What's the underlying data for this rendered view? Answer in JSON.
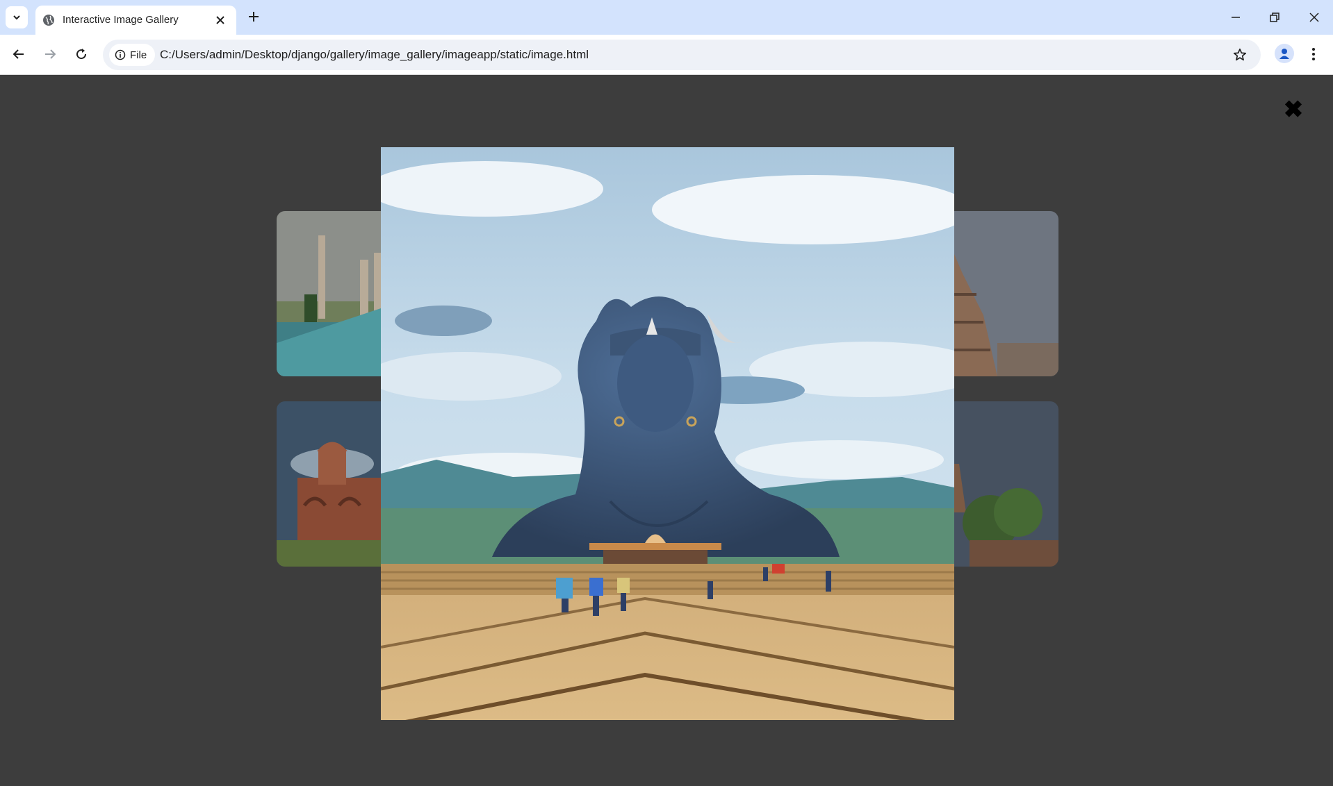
{
  "browser": {
    "tab": {
      "title": "Interactive Image Gallery",
      "favicon": "globe-icon",
      "close_icon": "close-icon"
    },
    "new_tab_icon": "plus-icon",
    "window_controls": [
      "minimize-icon",
      "restore-icon",
      "close-icon"
    ],
    "toolbar": {
      "back_icon": "back-arrow-icon",
      "forward_icon": "forward-arrow-icon",
      "reload_icon": "reload-icon",
      "site_info_label": "File",
      "url": "C:/Users/admin/Desktop/django/gallery/image_gallery/imageapp/static/image.html",
      "bookmark_icon": "star-icon",
      "profile_icon": "person-icon",
      "menu_icon": "kebab-menu-icon"
    },
    "colors": {
      "tabstrip": "#d3e3fd",
      "page_background": "#3d3d3d"
    }
  },
  "gallery": {
    "thumbnails": [
      {
        "subject": "taj-mahal"
      },
      {
        "subject": "stone-temple-spire"
      },
      {
        "subject": "red-fort"
      },
      {
        "subject": "gopuram-temple"
      }
    ],
    "lightbox": {
      "subject": "adiyogi-shiva-statue",
      "close_icon": "close-x-icon",
      "close_glyph": "✖"
    }
  }
}
